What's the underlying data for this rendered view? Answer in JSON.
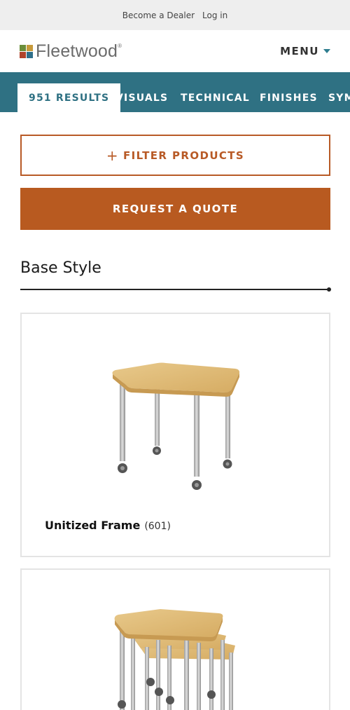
{
  "topbar": {
    "become_dealer": "Become a Dealer",
    "login": "Log in"
  },
  "header": {
    "logo_text": "Fleetwood",
    "logo_reg": "®",
    "menu_label": "MENU"
  },
  "tabs": [
    {
      "label": "951 RESULTS",
      "active": true
    },
    {
      "label": "VISUALS",
      "active": false
    },
    {
      "label": "TECHNICAL",
      "active": false
    },
    {
      "label": "FINISHES",
      "active": false
    },
    {
      "label": "SYM",
      "active": false
    }
  ],
  "buttons": {
    "filter_icon": "+",
    "filter_label": "FILTER PRODUCTS",
    "quote_label": "REQUEST A QUOTE"
  },
  "section": {
    "title": "Base Style"
  },
  "products": [
    {
      "name": "Unitized Frame",
      "count": "(601)",
      "image": "rectangular-table-on-casters-icon"
    },
    {
      "name": "",
      "count": "",
      "image": "nesting-tables-on-casters-icon"
    }
  ],
  "colors": {
    "teal": "#2f7183",
    "orange": "#b85a20",
    "logo_green": "#6b8e3a",
    "logo_red": "#b0432b",
    "logo_blue": "#2f6f8a",
    "logo_gold": "#c79a3a"
  }
}
